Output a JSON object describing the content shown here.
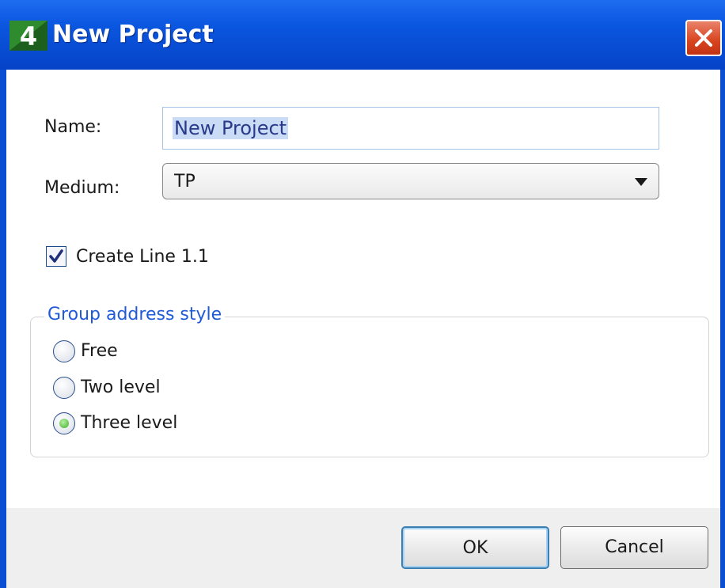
{
  "window": {
    "title": "New Project",
    "app_icon": "knx-4-icon",
    "close_icon": "close-icon"
  },
  "form": {
    "name_label": "Name:",
    "name_value": "New Project",
    "medium_label": "Medium:",
    "medium_value": "TP",
    "create_line_label": "Create Line 1.1",
    "create_line_checked": true
  },
  "group_address": {
    "legend": "Group address style",
    "options": [
      {
        "label": "Free",
        "selected": false
      },
      {
        "label": "Two level",
        "selected": false
      },
      {
        "label": "Three level",
        "selected": true
      }
    ]
  },
  "buttons": {
    "ok": "OK",
    "cancel": "Cancel"
  },
  "colors": {
    "titlebar": "#0543c8",
    "legend": "#1f5ad8",
    "close": "#d8431f"
  }
}
